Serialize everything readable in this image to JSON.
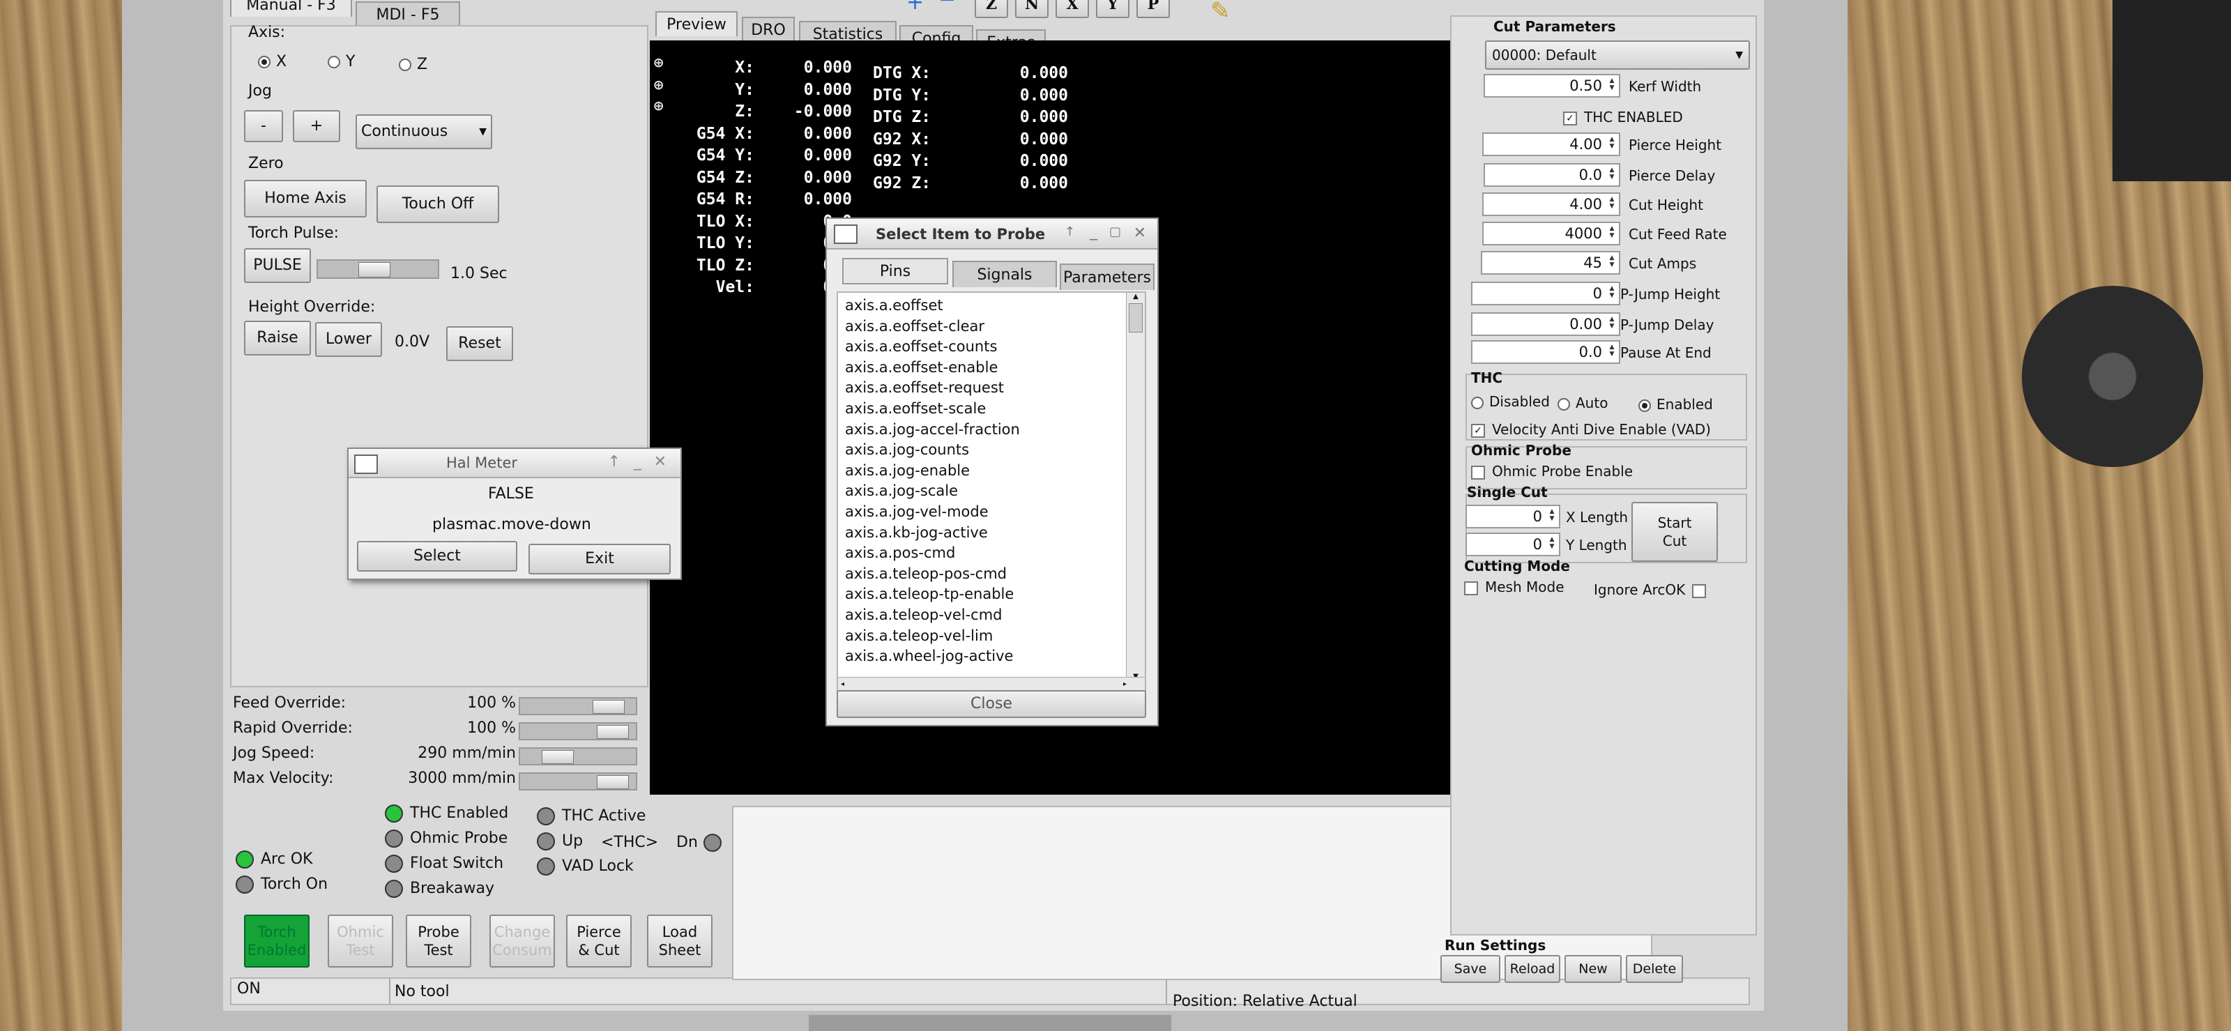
{
  "tabs_left": [
    "Manual - F3",
    "MDI - F5"
  ],
  "axis": {
    "label": "Axis:",
    "options": [
      "X",
      "Y",
      "Z"
    ],
    "selected": "X"
  },
  "jog": {
    "label": "Jog",
    "minus": "-",
    "plus": "+",
    "mode": "Continuous"
  },
  "zero": {
    "label": "Zero",
    "home": "Home Axis",
    "touch_off": "Touch Off"
  },
  "torch_pulse": {
    "label": "Torch Pulse:",
    "button": "PULSE",
    "value": "1.0 Sec",
    "slider_level": 0.45
  },
  "height_override": {
    "label": "Height Override:",
    "raise": "Raise",
    "lower": "Lower",
    "value": "0.0V",
    "reset": "Reset"
  },
  "overrides": [
    {
      "label": "Feed Override:",
      "value": "100 %",
      "level": 0.85
    },
    {
      "label": "Rapid Override:",
      "value": "100 %",
      "level": 0.9
    },
    {
      "label": "Jog Speed:",
      "value": "290 mm/min",
      "level": 0.25
    },
    {
      "label": "Max Velocity:",
      "value": "3000 mm/min",
      "level": 0.9
    }
  ],
  "leds_col1": [
    {
      "label": "Arc OK",
      "state": "green"
    },
    {
      "label": "Torch On",
      "state": "gray"
    }
  ],
  "leds_col2": [
    {
      "label": "THC Enabled",
      "state": "green"
    },
    {
      "label": "Ohmic Probe",
      "state": "gray"
    },
    {
      "label": "Float Switch",
      "state": "gray"
    },
    {
      "label": "Breakaway",
      "state": "gray"
    }
  ],
  "leds_col3": [
    {
      "label": "THC Active",
      "state": "gray"
    },
    {
      "label": "Up",
      "state": "gray"
    },
    {
      "label": "VAD Lock",
      "state": "gray"
    }
  ],
  "thc_mid": "<THC>",
  "thc_dn": "Dn",
  "bottom_buttons": [
    {
      "line1": "Torch",
      "line2": "Enabled"
    },
    {
      "line1": "Ohmic",
      "line2": "Test"
    },
    {
      "line1": "Probe",
      "line2": "Test"
    },
    {
      "line1": "Change",
      "line2": "Consum"
    },
    {
      "line1": "Pierce",
      "line2": "& Cut"
    },
    {
      "line1": "Load",
      "line2": "Sheet"
    }
  ],
  "status": {
    "state": "ON",
    "tool": "No tool",
    "position": "Position: Relative Actual"
  },
  "center_tabs": [
    "Preview",
    "DRO",
    "Statistics",
    "Config",
    "Extras"
  ],
  "toolbar_letters": [
    "Z",
    "N",
    "X",
    "Y",
    "P"
  ],
  "dro": [
    {
      "label": "X:",
      "val": "0.000",
      "dlabel": "DTG X:",
      "dval": "0.000"
    },
    {
      "label": "Y:",
      "val": "0.000",
      "dlabel": "DTG Y:",
      "dval": "0.000"
    },
    {
      "label": "Z:",
      "val": "-0.000",
      "dlabel": "DTG Z:",
      "dval": "0.000"
    },
    {
      "label": "G54 X:",
      "val": "0.000",
      "dlabel": "G92 X:",
      "dval": "0.000"
    },
    {
      "label": "G54 Y:",
      "val": "0.000",
      "dlabel": "G92 Y:",
      "dval": "0.000"
    },
    {
      "label": "G54 Z:",
      "val": "0.000",
      "dlabel": "G92 Z:",
      "dval": "0.000"
    },
    {
      "label": "G54 R:",
      "val": "0.000",
      "dlabel": "",
      "dval": ""
    },
    {
      "label": "TLO X:",
      "val": "0.0",
      "dlabel": "",
      "dval": ""
    },
    {
      "label": "TLO Y:",
      "val": "0.0",
      "dlabel": "",
      "dval": ""
    },
    {
      "label": "TLO Z:",
      "val": "0.0",
      "dlabel": "",
      "dval": ""
    },
    {
      "label": "Vel:",
      "val": "0.0",
      "dlabel": "",
      "dval": ""
    }
  ],
  "probe_dialog": {
    "title": "Select Item to Probe",
    "tabs": [
      "Pins",
      "Signals",
      "Parameters"
    ],
    "items": [
      "axis.a.eoffset",
      "axis.a.eoffset-clear",
      "axis.a.eoffset-counts",
      "axis.a.eoffset-enable",
      "axis.a.eoffset-request",
      "axis.a.eoffset-scale",
      "axis.a.jog-accel-fraction",
      "axis.a.jog-counts",
      "axis.a.jog-enable",
      "axis.a.jog-scale",
      "axis.a.jog-vel-mode",
      "axis.a.kb-jog-active",
      "axis.a.pos-cmd",
      "axis.a.teleop-pos-cmd",
      "axis.a.teleop-tp-enable",
      "axis.a.teleop-vel-cmd",
      "axis.a.teleop-vel-lim",
      "axis.a.wheel-jog-active"
    ],
    "close": "Close"
  },
  "hal_meter": {
    "title": "Hal Meter",
    "value": "FALSE",
    "pin": "plasmac.move-down",
    "select": "Select",
    "exit": "Exit"
  },
  "cut_params": {
    "title": "Cut Parameters",
    "material": "00000: Default",
    "rows": [
      {
        "value": "0.50",
        "label": "Kerf Width"
      },
      {
        "value": "4.00",
        "label": "Pierce Height"
      },
      {
        "value": "0.0",
        "label": "Pierce Delay"
      },
      {
        "value": "4.00",
        "label": "Cut Height"
      },
      {
        "value": "4000",
        "label": "Cut Feed Rate"
      },
      {
        "value": "45",
        "label": "Cut Amps"
      },
      {
        "value": "0",
        "label": "P-Jump Height"
      },
      {
        "value": "0.00",
        "label": "P-Jump Delay"
      },
      {
        "value": "0.0",
        "label": "Pause At End"
      }
    ],
    "thc_enabled": "THC ENABLED"
  },
  "thc": {
    "title": "THC",
    "options": [
      "Disabled",
      "Auto",
      "Enabled"
    ],
    "selected": "Enabled",
    "vad": "Velocity Anti Dive Enable (VAD)"
  },
  "ohmic": {
    "title": "Ohmic Probe",
    "enable": "Ohmic Probe Enable"
  },
  "single_cut": {
    "title": "Single Cut",
    "x_value": "0",
    "x_label": "X Length",
    "y_value": "0",
    "y_label": "Y Length",
    "start": "Start",
    "cut": "Cut"
  },
  "cutting_mode": {
    "title": "Cutting Mode",
    "mesh": "Mesh Mode",
    "ignore": "Ignore ArcOK"
  },
  "run_settings": {
    "title": "Run Settings",
    "buttons": [
      "Save",
      "Reload",
      "New",
      "Delete"
    ]
  }
}
